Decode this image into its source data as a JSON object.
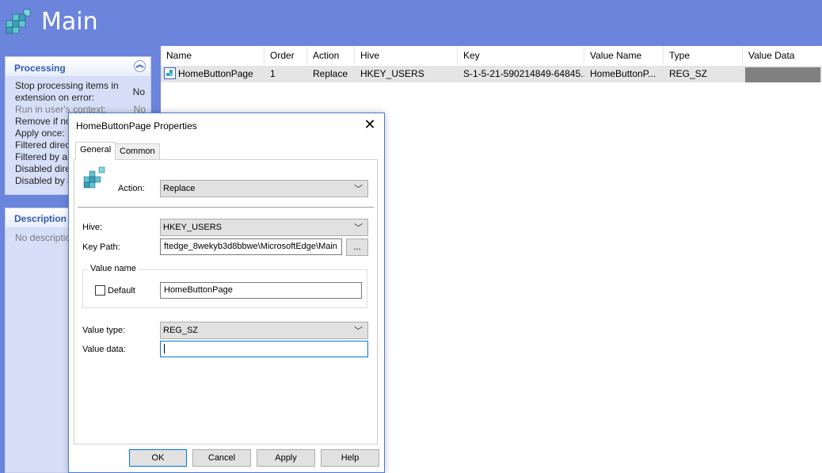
{
  "header": {
    "title": "Main"
  },
  "processing": {
    "title": "Processing",
    "rows": [
      {
        "label": "Stop processing items in extension on error:",
        "value": "No"
      },
      {
        "label": "Run in user's context:",
        "value": "No"
      },
      {
        "label": "Remove if no",
        "value": ""
      },
      {
        "label": "Apply once:",
        "value": ""
      },
      {
        "label": "Filtered direc",
        "value": ""
      },
      {
        "label": "Filtered by ar",
        "value": ""
      },
      {
        "label": "Disabled direc",
        "value": ""
      },
      {
        "label": "Disabled by a",
        "value": ""
      }
    ]
  },
  "description": {
    "title": "Description",
    "text": "No descriptio"
  },
  "list": {
    "columns": [
      "Name",
      "Order",
      "Action",
      "Hive",
      "Key",
      "Value Name",
      "Type",
      "Value Data"
    ],
    "rows": [
      {
        "name": "HomeButtonPage",
        "order": "1",
        "action": "Replace",
        "hive": "HKEY_USERS",
        "key": "S-1-5-21-590214849-64845...",
        "value_name": "HomeButtonP...",
        "type": "REG_SZ",
        "value_data": ""
      }
    ]
  },
  "dialog": {
    "title": "HomeButtonPage Properties",
    "tabs": [
      "General",
      "Common"
    ],
    "action_label": "Action:",
    "action_value": "Replace",
    "hive_label": "Hive:",
    "hive_value": "HKEY_USERS",
    "keypath_label": "Key Path:",
    "keypath_value": "ftedge_8wekyb3d8bbwe\\MicrosoftEdge\\Main",
    "browse_label": "...",
    "value_name_group": "Value name",
    "default_label": "Default",
    "value_name_value": "HomeButtonPage",
    "value_type_label": "Value type:",
    "value_type_value": "REG_SZ",
    "value_data_label": "Value data:",
    "value_data_value": "",
    "buttons": {
      "ok": "OK",
      "cancel": "Cancel",
      "apply": "Apply",
      "help": "Help"
    }
  }
}
